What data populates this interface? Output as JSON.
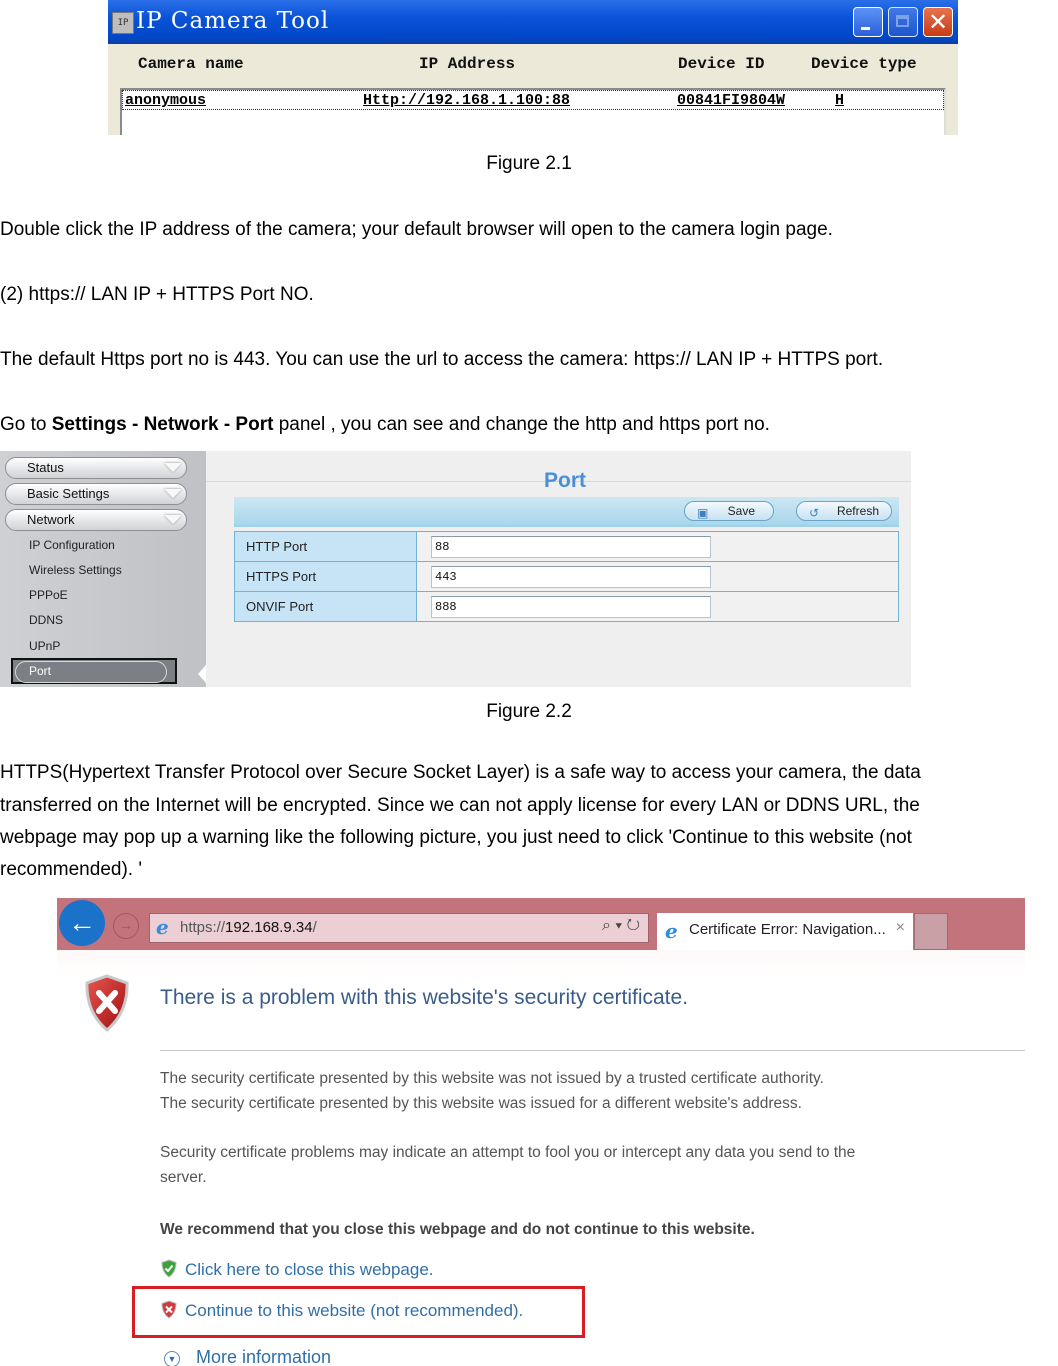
{
  "figure1": {
    "window_title": "IP Camera Tool",
    "app_icon": "camera-tool-icon",
    "window_controls": [
      "minimize",
      "maximize",
      "close"
    ],
    "columns": [
      "Camera name",
      "IP Address",
      "Device ID",
      "Device type"
    ],
    "rows": [
      {
        "camera_name": "anonymous",
        "ip_address": "Http://192.168.1.100:88",
        "device_id": "00841FI9804W",
        "device_type": "H"
      }
    ],
    "caption": "Figure 2.1"
  },
  "para1": "Double click the IP address of the camera; your default browser will open to the camera login page.",
  "para2": "(2) https:// LAN IP + HTTPS Port NO.",
  "para3": "The default Https port no is 443. You can use the url to access the camera: https:// LAN IP + HTTPS port.",
  "para4": {
    "prefix": "Go to ",
    "bold": "Settings - Network - Port",
    "suffix": " panel , you can see and change the http and https port no."
  },
  "figure2": {
    "sidebar": {
      "menus": [
        "Status",
        "Basic Settings",
        "Network"
      ],
      "network_items": [
        "IP Configuration",
        "Wireless Settings",
        "PPPoE",
        "DDNS",
        "UPnP",
        "Port"
      ],
      "active_item": "Port"
    },
    "page_title": "Port",
    "toolbar": {
      "save_label": "Save",
      "refresh_label": "Refresh"
    },
    "fields": [
      {
        "label": "HTTP Port",
        "value": "88"
      },
      {
        "label": "HTTPS Port",
        "value": "443"
      },
      {
        "label": "ONVIF Port",
        "value": "888"
      }
    ],
    "accent_color": "#4a8fd8",
    "caption": "Figure 2.2"
  },
  "para5": [
    "HTTPS(Hypertext Transfer Protocol over Secure Socket Layer) is a safe way to access your camera, the data",
    "transferred on the Internet will be encrypted. Since we can not apply license for every LAN or DDNS URL, the",
    "webpage may pop up a warning like the following picture, you just need to click 'Continue to this website (not",
    "recommended). '"
  ],
  "figure3": {
    "address": {
      "prefix": "https://",
      "host": "192.168.9.34",
      "suffix": "/"
    },
    "search_controls": "⌕ ▾ ↻",
    "tab_title": "Certificate Error: Navigation...",
    "tab_close": "×",
    "error_title": "There is a problem with this website's security certificate.",
    "details": [
      "The security certificate presented by this website was not issued by a trusted certificate authority.",
      "The security certificate presented by this website was issued for a different website's address."
    ],
    "warning": [
      "Security certificate problems may indicate an attempt to fool you or intercept any data you send to the",
      "server."
    ],
    "recommendation": "We recommend that you close this webpage and do not continue to this website.",
    "close_link": "Click here to close this webpage.",
    "continue_link": "Continue to this website (not recommended).",
    "more_info": "More information",
    "chrome_color": "#c2737c",
    "highlight_color": "#d81e24"
  }
}
